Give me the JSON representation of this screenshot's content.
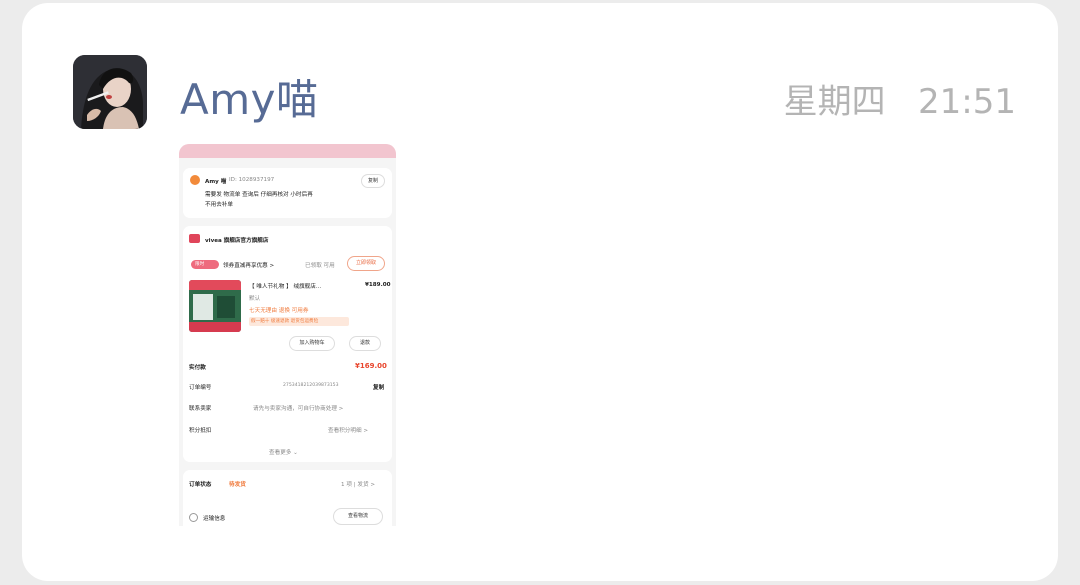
{
  "message": {
    "sender_name": "Amy喵",
    "time": "星期四   21:51"
  },
  "shot": {
    "header_name": "Amy 喵",
    "header_sub": "ID: 1028937197",
    "header_btn": "复制",
    "header_text_1": "需要发 物流单 查询后 仔细再核对 小时后再",
    "header_text_2": "不用去补单",
    "shop_name": "vivea 旗舰店官方旗舰店",
    "promo_tag": "限时",
    "promo_text": "领券直减再享优惠 >",
    "promo_grey": "已领取 可用",
    "promo_btn": "立即领取",
    "product_title": "【 唯人节礼物 】 绒旗舰店...",
    "product_price": "¥189.00",
    "product_sku": "默认",
    "product_desc": "七天无理由 退换 可用券",
    "product_tags": "假一赔十 极速退款 退货包运费险",
    "btn_add": "加入购物车",
    "btn_refund": "退款",
    "label_paid": "实付款",
    "value_paid": "¥169.00",
    "label_order": "订单编号",
    "value_order": "2753418212039873153",
    "copy": "复制",
    "label_contact": "联系卖家",
    "value_contact": "请先与卖家沟通，可自行协商处理 >",
    "label_points": "积分抵扣",
    "value_points": "查看积分明细 >",
    "view_more": "查看更多 ⌄",
    "label_status": "订单状态",
    "status_value": "待发货",
    "status_right": "1 项 | 发货 >",
    "label_logistics": "运输信息",
    "btn_view": "查看物流"
  }
}
